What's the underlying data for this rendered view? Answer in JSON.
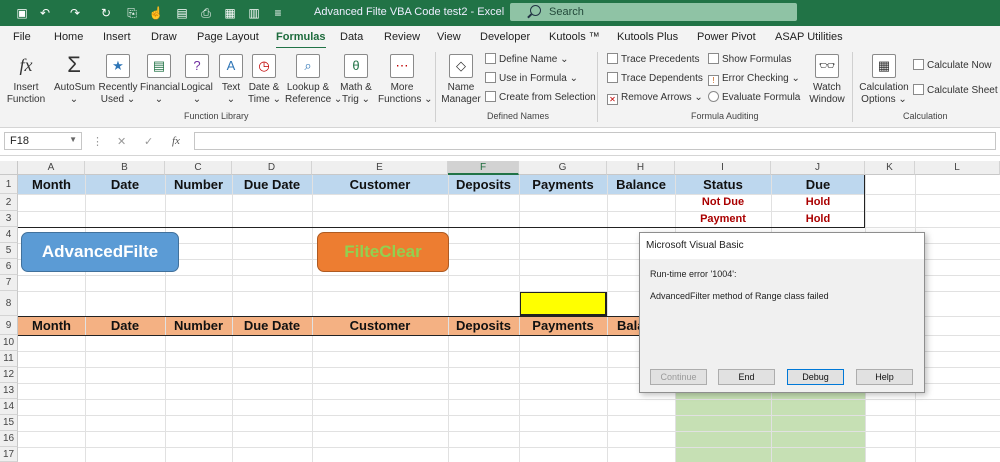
{
  "titlebar": {
    "title": "Advanced Filte VBA Code test2  -  Excel",
    "search_placeholder": "Search"
  },
  "tabs": [
    "File",
    "Home",
    "Insert",
    "Draw",
    "Page Layout",
    "Formulas",
    "Data",
    "Review",
    "View",
    "Developer",
    "Kutools ™",
    "Kutools Plus",
    "Power Pivot",
    "ASAP Utilities"
  ],
  "active_tab": "Formulas",
  "ribbon": {
    "insert_function": [
      "Insert",
      "Function"
    ],
    "autosum": [
      "AutoSum"
    ],
    "recently_used": [
      "Recently",
      "Used"
    ],
    "financial": [
      "Financial"
    ],
    "logical": [
      "Logical"
    ],
    "text": [
      "Text"
    ],
    "date_time": [
      "Date &",
      "Time"
    ],
    "lookup_reference": [
      "Lookup &",
      "Reference"
    ],
    "math_trig": [
      "Math &",
      "Trig"
    ],
    "more_functions": [
      "More",
      "Functions"
    ],
    "group_function_library": "Function Library",
    "name_manager": [
      "Name",
      "Manager"
    ],
    "define_name": "Define Name",
    "use_in_formula": "Use in Formula",
    "create_from_selection": "Create from Selection",
    "group_defined_names": "Defined Names",
    "trace_precedents": "Trace Precedents",
    "trace_dependents": "Trace Dependents",
    "remove_arrows": "Remove Arrows",
    "show_formulas": "Show Formulas",
    "error_checking": "Error Checking",
    "evaluate_formula": "Evaluate Formula",
    "watch_window": [
      "Watch",
      "Window"
    ],
    "group_formula_auditing": "Formula Auditing",
    "calculation_options": [
      "Calculation",
      "Options"
    ],
    "calculate_now": "Calculate Now",
    "calculate_sheet": "Calculate Sheet",
    "group_calculation": "Calculation"
  },
  "formula_bar": {
    "name_box": "F18",
    "fx": "fx",
    "cancel": "✕",
    "enter": "✓",
    "formula": ""
  },
  "columns": [
    "A",
    "B",
    "C",
    "D",
    "E",
    "F",
    "G",
    "H",
    "I",
    "J",
    "K",
    "L"
  ],
  "rows": [
    "1",
    "2",
    "3",
    "4",
    "5",
    "6",
    "7",
    "8",
    "9",
    "10",
    "11",
    "12",
    "13",
    "14",
    "15",
    "16",
    "17"
  ],
  "header_row1": [
    "Month",
    "Date",
    "Number",
    "Due Date",
    "Customer",
    "Deposits",
    "Payments",
    "Balance",
    "Status",
    "Due"
  ],
  "header_row9": [
    "Month",
    "Date",
    "Number",
    "Due Date",
    "Customer",
    "Deposits",
    "Payments",
    "Bala"
  ],
  "row2": {
    "status": "Not Due",
    "due": "Hold"
  },
  "row3": {
    "status": "Payment",
    "due": "Hold"
  },
  "buttons": {
    "advanced_filter": "AdvancedFilte",
    "filter_clear": "FilteClear"
  },
  "colors": {
    "header_blue": "#bdd7ee",
    "header_orange": "#f4b183",
    "yellow": "#ffff00",
    "green_fill": "#c6e0b4",
    "excel_green": "#217346"
  },
  "dialog": {
    "title": "Microsoft Visual Basic",
    "line1": "Run-time error '1004':",
    "line2": "AdvancedFilter method of Range class failed",
    "continue": "Continue",
    "end": "End",
    "debug": "Debug",
    "help": "Help"
  }
}
